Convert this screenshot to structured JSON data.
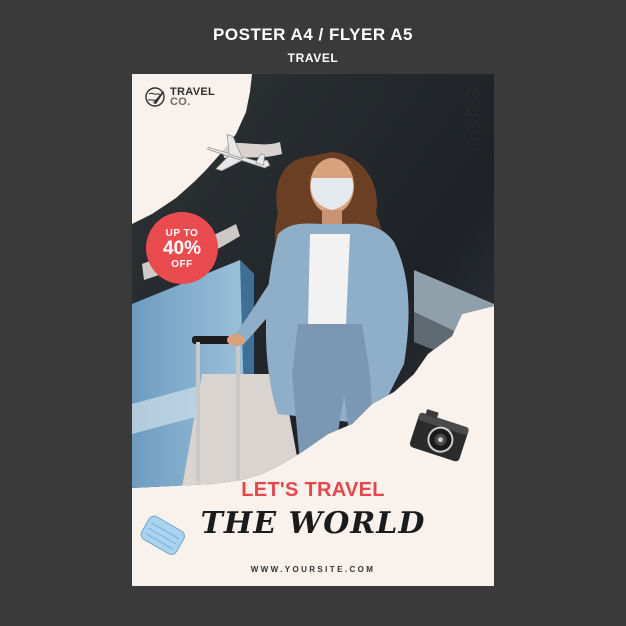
{
  "header": {
    "title": "POSTER A4 / FLYER A5",
    "subtitle": "TRAVEL"
  },
  "logo": {
    "line1": "TRAVEL",
    "line2": "CO.",
    "icon": "globe-plane-icon"
  },
  "social": [
    "facebook-icon",
    "twitter-icon",
    "pinterest-icon",
    "instagram-icon"
  ],
  "badge": {
    "line1": "UP TO",
    "line2": "40%",
    "line3": "OFF"
  },
  "headline": {
    "line1": "LET'S TRAVEL",
    "line2": "THE WORLD"
  },
  "website": "WWW.YOURSITE.COM",
  "colors": {
    "background": "#3a3a3a",
    "poster": "#f8f1ec",
    "accent": "#e94b4f",
    "text": "#1b1b1b"
  }
}
